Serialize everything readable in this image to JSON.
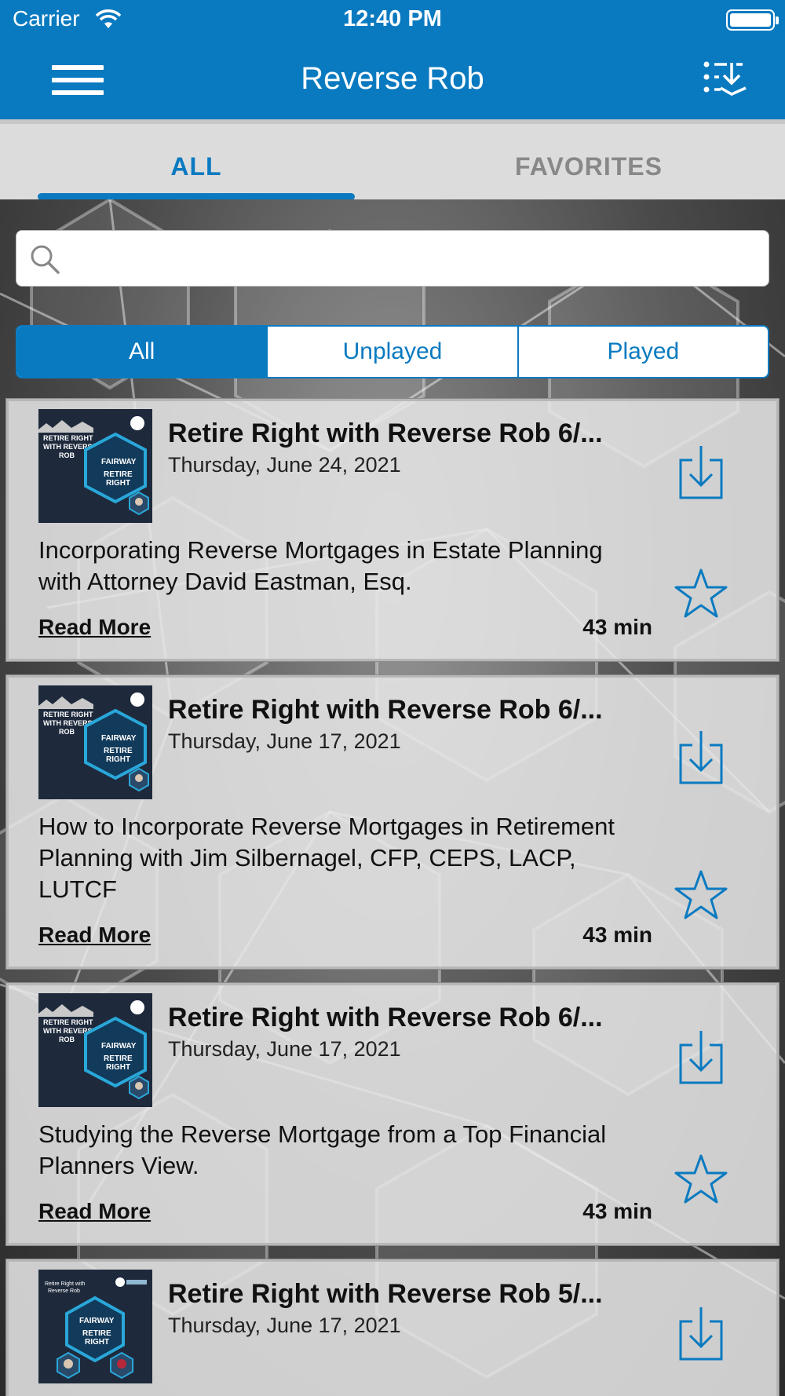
{
  "status_bar": {
    "carrier": "Carrier",
    "time": "12:40 PM"
  },
  "nav": {
    "title": "Reverse Rob"
  },
  "tabs": [
    {
      "label": "ALL",
      "active": true
    },
    {
      "label": "FAVORITES",
      "active": false
    }
  ],
  "search": {
    "placeholder": "",
    "value": ""
  },
  "filter": {
    "options": [
      "All",
      "Unplayed",
      "Played"
    ],
    "selected": "All"
  },
  "colors": {
    "accent": "#0a7ac0"
  },
  "episodes": [
    {
      "title": "Retire Right with Reverse Rob  6/...",
      "date": "Thursday, June 24, 2021",
      "description": "Incorporating Reverse Mortgages in Estate Planning with Attorney David Eastman, Esq.",
      "read_more": "Read More",
      "duration": "43 min"
    },
    {
      "title": "Retire Right with Reverse Rob 6/...",
      "date": "Thursday, June 17, 2021",
      "description": "How to Incorporate Reverse Mortgages in Retirement Planning with Jim Silbernagel, CFP, CEPS, LACP, LUTCF",
      "read_more": "Read More",
      "duration": "43 min"
    },
    {
      "title": "Retire Right with Reverse Rob 6/...",
      "date": "Thursday, June 17, 2021",
      "description": "Studying the Reverse Mortgage from a Top Financial Planners View.",
      "read_more": "Read More",
      "duration": "43 min"
    },
    {
      "title": "Retire Right with Reverse Rob 5/...",
      "date": "Thursday, June 17, 2021",
      "description": "",
      "read_more": "",
      "duration": ""
    }
  ],
  "thumbnail_text": {
    "show_name_lines": [
      "RETIRE RIGHT",
      "WITH REVERSE",
      "ROB"
    ],
    "brand": "FAIRWAY",
    "badge_lines": [
      "RETIRE",
      "RIGHT"
    ]
  }
}
